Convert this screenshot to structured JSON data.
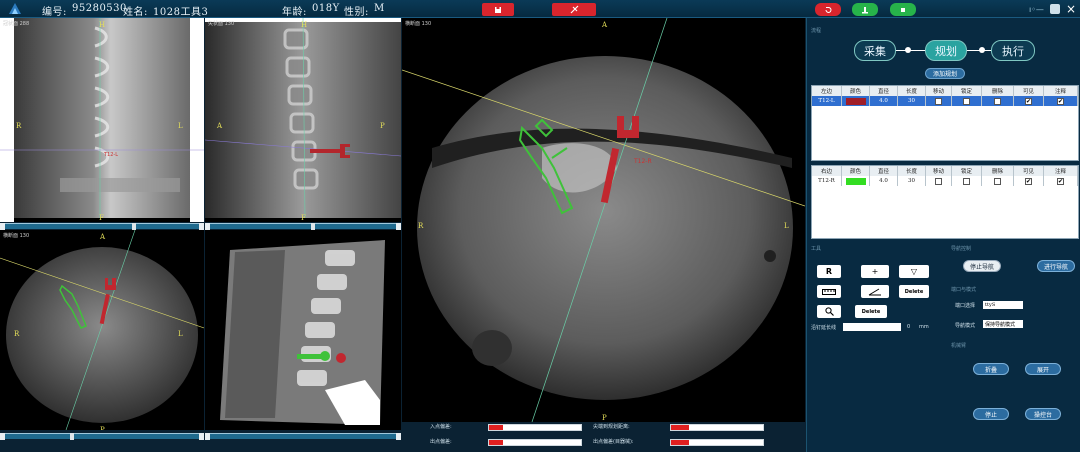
{
  "header": {
    "id_label": "编号:",
    "id_value": "95280530",
    "name_label": "姓名:",
    "name_value": "1028工具3",
    "age_label": "年龄:",
    "age_value": "018Y",
    "sex_label": "性别:",
    "sex_value": "M"
  },
  "views": {
    "sagittal_label": "冠状面",
    "sagittal_num": "288",
    "lateral_label": "矢状面",
    "lateral_num": "130",
    "axial_label": "横断面",
    "axial_num": "130",
    "axial_small_label": "横断面",
    "axial_small_num": "130",
    "orient": {
      "H": "H",
      "F": "F",
      "R": "R",
      "L": "L",
      "A": "A",
      "P": "P"
    }
  },
  "workflow": {
    "steps": [
      "采集",
      "规划",
      "执行"
    ],
    "active": "规划"
  },
  "add_plan_label": "添加规划",
  "left_table": {
    "headers": [
      "左边",
      "颜色",
      "直径",
      "长度",
      "移动",
      "锁定",
      "删除",
      "可见",
      "注释"
    ],
    "row": {
      "name": "T12-L",
      "color": "#a01e28",
      "diameter": "4.0",
      "length": "30",
      "visible": "✔",
      "note": "✔"
    }
  },
  "right_table": {
    "headers": [
      "右边",
      "颜色",
      "直径",
      "长度",
      "移动",
      "锁定",
      "删除",
      "可见",
      "注释"
    ],
    "row": {
      "name": "T12-R",
      "color": "#33dd22",
      "diameter": "4.0",
      "length": "30",
      "visible": "✔",
      "note": "✔"
    }
  },
  "tools": {
    "r_label": "R",
    "plus_label": "+",
    "tri_label": "▽",
    "delete1": "Delete",
    "delete2": "Delete",
    "extend_label": "沿钉延长线",
    "extend_unit": "mm",
    "extend_value": "0"
  },
  "nav": {
    "stop_nav": "停止导航",
    "start_nav": "进行导航",
    "port_label": "端口选择",
    "port_value": "ttyS",
    "mode_label": "导航模式",
    "mode_value": "保持导航模式",
    "fold": "折叠",
    "expand": "展开",
    "stop": "停止",
    "console": "操控台"
  },
  "bottom": {
    "in_offset_label": "入点偏差:",
    "out_offset_label": "出点偏差:",
    "tip_dist_label": "尖端到规划距离:",
    "tip_dev_label": "出点偏差(目器械):",
    "in_offset_value": 0.15,
    "out_offset_value": 0.15,
    "tip_dist_value": 0.2,
    "tip_dev_value": 0.2
  },
  "colors": {
    "accent": "#2aa3a0",
    "alert": "#d8252d",
    "ok": "#27b34a"
  }
}
